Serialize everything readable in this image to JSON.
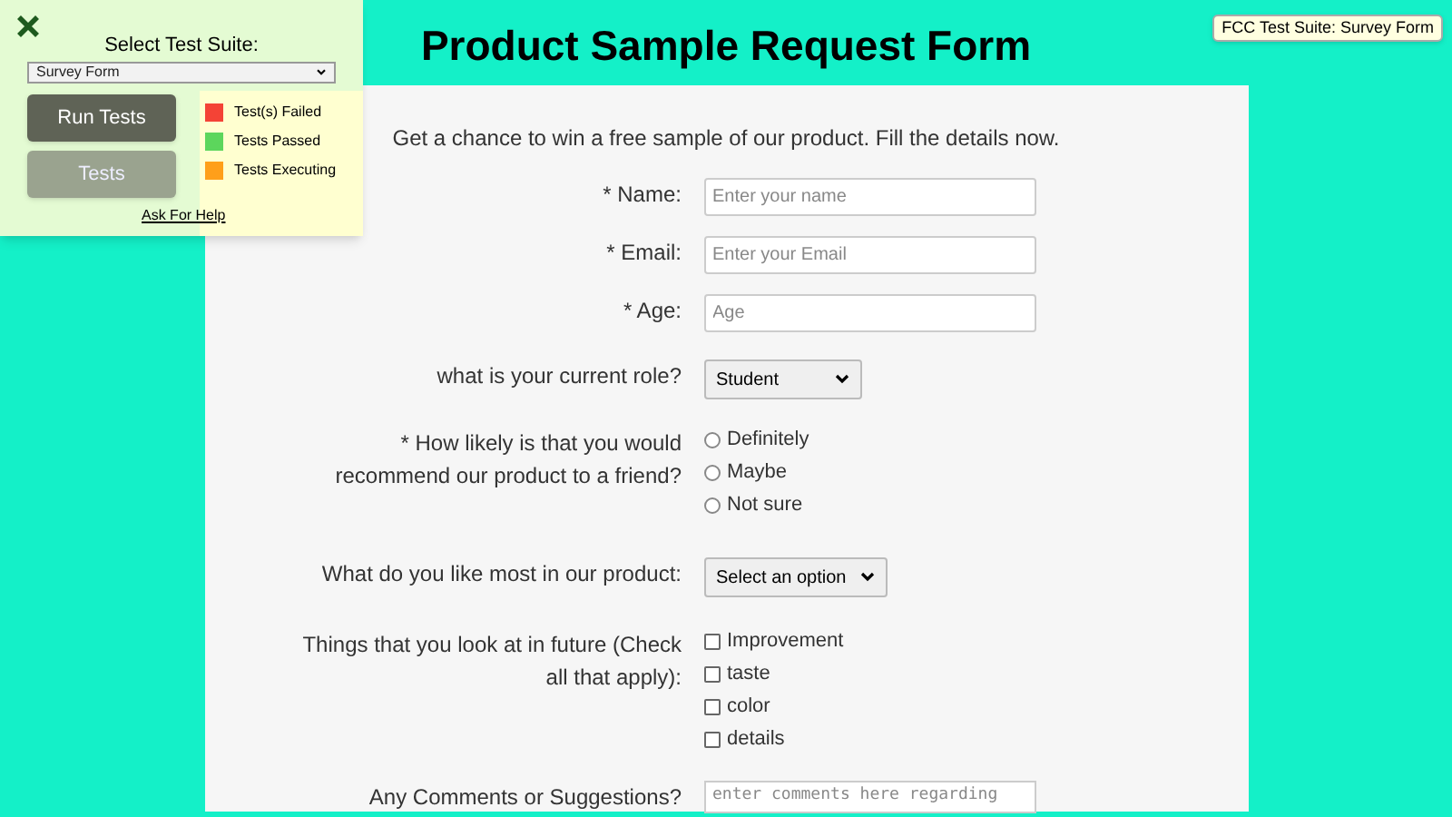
{
  "title": "Product Sample Request Form",
  "test_panel": {
    "heading": "Select Test Suite:",
    "suite_select": "Survey Form",
    "buttons": [
      "Run Tests",
      "Tests"
    ],
    "legend": [
      {
        "label": "Test(s) Failed",
        "color": "#f44336"
      },
      {
        "label": "Tests Passed",
        "color": "#5cd65c"
      },
      {
        "label": "Tests Executing",
        "color": "#ff9f1a"
      }
    ],
    "help_link": "Ask For Help"
  },
  "suite_badge": "FCC Test Suite: Survey Form",
  "form": {
    "intro": "Get a chance to win a free sample of our product. Fill the details now.",
    "fields": [
      {
        "kind": "text",
        "label": "* Name:",
        "placeholder": "Enter your name"
      },
      {
        "kind": "text",
        "label": "* Email:",
        "placeholder": "Enter your Email"
      },
      {
        "kind": "text",
        "label": "* Age:",
        "placeholder": "Age"
      },
      {
        "kind": "select",
        "label": "what is your current role?",
        "value": "Student"
      },
      {
        "kind": "radio",
        "label": "* How likely is that you would recommend our product to a friend?",
        "options": [
          {
            "label": "Definitely",
            "selected": false
          },
          {
            "label": "Maybe",
            "selected": false
          },
          {
            "label": "Not sure",
            "selected": false
          }
        ]
      },
      {
        "kind": "select",
        "label": "What do you like most in our product:",
        "value": "Select an option"
      },
      {
        "kind": "checkbox",
        "label": "Things that you look at in future (Check all that apply):",
        "options": [
          {
            "label": "Improvement",
            "checked": false
          },
          {
            "label": "taste",
            "checked": false
          },
          {
            "label": "color",
            "checked": false
          },
          {
            "label": "details",
            "checked": false
          }
        ]
      },
      {
        "kind": "textarea",
        "label": "Any Comments or Suggestions?",
        "placeholder": "enter comments here regarding"
      }
    ]
  }
}
